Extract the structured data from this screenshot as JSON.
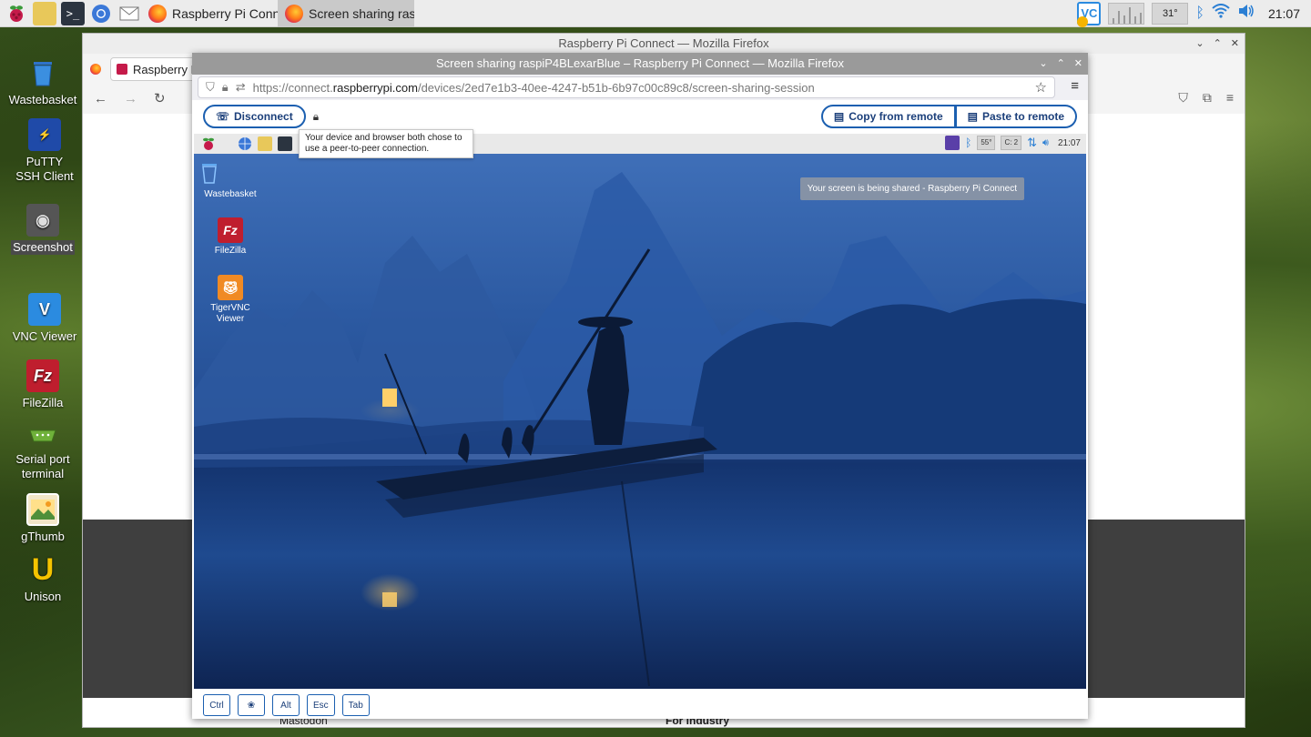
{
  "taskbar": {
    "tasks": [
      {
        "label": "Raspberry Pi Connec...",
        "active": false
      },
      {
        "label": "Screen sharing raspi...",
        "active": true
      }
    ],
    "temperature": "31°",
    "clock": "21:07",
    "vnc_label": "VC"
  },
  "desktop": {
    "icons": [
      {
        "label": "Wastebasket"
      },
      {
        "label": "PuTTY SSH Client"
      },
      {
        "label": "Screenshot"
      },
      {
        "label": "VNC Viewer"
      },
      {
        "label": "FileZilla"
      },
      {
        "label": "Serial port terminal"
      },
      {
        "label": "gThumb"
      },
      {
        "label": "Unison"
      }
    ]
  },
  "back_window": {
    "title": "Raspberry Pi Connect — Mozilla Firefox",
    "tab_label": "Raspberry Pi Connect",
    "footer_left": "Mastodon",
    "footer_right": "For industry"
  },
  "front_window": {
    "title": "Screen sharing raspiP4BLexarBlue – Raspberry Pi Connect — Mozilla Firefox",
    "url_prefix": "https://connect.",
    "url_domain": "raspberrypi.com",
    "url_path": "/devices/2ed7e1b3-40ee-4247-b51b-6b97c00c89c8/screen-sharing-session",
    "disconnect_label": "Disconnect",
    "copy_label": "Copy from remote",
    "paste_label": "Paste to remote",
    "tooltip": "Your device and browser both chose to use a peer-to-peer connection.",
    "keys": [
      "Ctrl",
      "❀",
      "Alt",
      "Esc",
      "Tab"
    ]
  },
  "remote": {
    "temp": "55°",
    "cpu": "C: 2",
    "clock": "21:07",
    "notification": "Your screen is being shared - Raspberry Pi Connect",
    "icons": [
      {
        "label": "Wastebasket"
      },
      {
        "label": "FileZilla"
      },
      {
        "label": "TigerVNC Viewer"
      }
    ]
  },
  "colors": {
    "accent": "#1b5fb0",
    "raspberry": "#c51a4a"
  }
}
